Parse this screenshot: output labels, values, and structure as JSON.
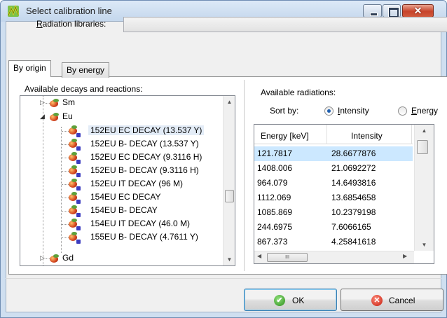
{
  "window": {
    "title": "Select calibration line",
    "close_glyph": "✕"
  },
  "libraries": {
    "label_prefix": "",
    "label_accel": "R",
    "label_rest": "adiation libraries:",
    "value": ""
  },
  "tabs": [
    {
      "label": "By origin",
      "active": true
    },
    {
      "label": "By energy",
      "active": false
    }
  ],
  "decays": {
    "label": "Available decays and reactions:",
    "nodes": [
      {
        "label": "Sm",
        "level": 0,
        "expanded": false
      },
      {
        "label": "Eu",
        "level": 0,
        "expanded": true
      },
      {
        "label": "152EU EC DECAY (13.537 Y)",
        "level": 1,
        "selected": true
      },
      {
        "label": "152EU B- DECAY (13.537 Y)",
        "level": 1
      },
      {
        "label": "152EU EC DECAY (9.3116 H)",
        "level": 1
      },
      {
        "label": "152EU B- DECAY (9.3116 H)",
        "level": 1
      },
      {
        "label": "152EU IT DECAY (96 M)",
        "level": 1
      },
      {
        "label": "154EU EC DECAY",
        "level": 1
      },
      {
        "label": "154EU B- DECAY",
        "level": 1
      },
      {
        "label": "154EU IT DECAY (46.0 M)",
        "level": 1
      },
      {
        "label": "155EU B- DECAY (4.7611 Y)",
        "level": 1
      },
      {
        "label": "Gd",
        "level": 0,
        "expanded": false
      }
    ]
  },
  "radiations": {
    "label": "Available radiations:",
    "sort_by": "Sort by:",
    "sort_intensity_accel": "I",
    "sort_intensity_rest": "ntensity",
    "sort_energy_accel": "E",
    "sort_energy_rest": "nergy",
    "sort_selected": "intensity",
    "columns": [
      "Energy [keV]",
      "Intensity"
    ],
    "rows": [
      [
        "121.7817",
        "28.6677876"
      ],
      [
        "1408.006",
        "21.0692272"
      ],
      [
        "964.079",
        "14.6493816"
      ],
      [
        "1112.069",
        "13.6854658"
      ],
      [
        "1085.869",
        "10.2379198"
      ],
      [
        "244.6975",
        "7.6066165"
      ],
      [
        "867.373",
        "4.25841618"
      ]
    ],
    "hscroll_grip": "III"
  },
  "buttons": {
    "ok": "OK",
    "cancel": "Cancel"
  },
  "colors": {
    "selection": "#cce8ff",
    "ok_icon": "#2d8d1c",
    "cancel_icon": "#c31b0b"
  }
}
